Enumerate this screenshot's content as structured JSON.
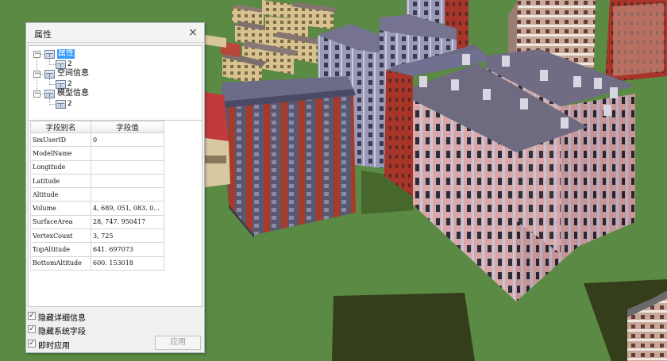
{
  "panel": {
    "title": "属性",
    "close_glyph": "×",
    "tree": [
      {
        "label": "属性",
        "selected": true,
        "child": "2"
      },
      {
        "label": "空间信息",
        "selected": false,
        "child": "2"
      },
      {
        "label": "模型信息",
        "selected": false,
        "child": "2"
      }
    ],
    "grid": {
      "header_name": "字段别名",
      "header_value": "字段值",
      "rows": [
        {
          "name": "SmUserID",
          "value": "0"
        },
        {
          "name": "ModelName",
          "value": ""
        },
        {
          "name": "Longitude",
          "value": ""
        },
        {
          "name": "Latitude",
          "value": ""
        },
        {
          "name": "Altitude",
          "value": ""
        },
        {
          "name": "Volume",
          "value": "4, 689, 051, 083. 0..."
        },
        {
          "name": "SurfaceArea",
          "value": "28, 747. 950417"
        },
        {
          "name": "VertexCount",
          "value": "3, 725"
        },
        {
          "name": "TopAltitude",
          "value": "641. 697073"
        },
        {
          "name": "BottomAltitude",
          "value": "600. 153018"
        }
      ]
    },
    "options": [
      {
        "label": "隐藏详细信息",
        "checked": true
      },
      {
        "label": "隐藏系统字段",
        "checked": true
      },
      {
        "label": "即时应用",
        "checked": true
      }
    ],
    "apply_label": "应用",
    "check_glyph": "✓",
    "expander_glyph": "−"
  },
  "scene": {
    "ground_color": "#5a8a44",
    "shadow_color": "#343e1a"
  }
}
